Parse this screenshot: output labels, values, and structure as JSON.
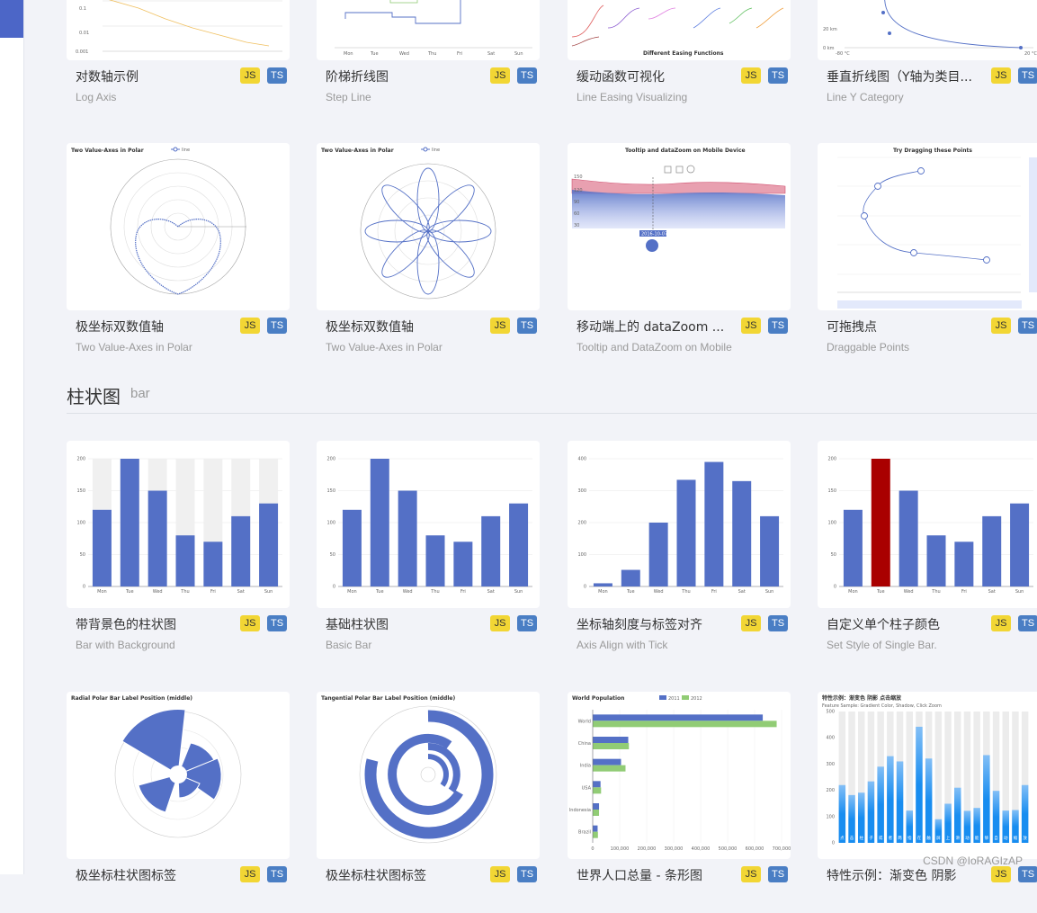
{
  "section": {
    "title": "柱状图",
    "subtitle": "bar"
  },
  "badges": {
    "js": "JS",
    "ts": "TS"
  },
  "cards_row1": [
    {
      "title": "对数轴示例",
      "subtitle": "Log Axis"
    },
    {
      "title": "阶梯折线图",
      "subtitle": "Step Line"
    },
    {
      "title": "缓动函数可视化",
      "subtitle": "Line Easing Visualizing"
    },
    {
      "title": "垂直折线图（Y轴为类目...",
      "subtitle": "Line Y Category"
    }
  ],
  "cards_row2": [
    {
      "title": "极坐标双数值轴",
      "subtitle": "Two Value-Axes in Polar"
    },
    {
      "title": "极坐标双数值轴",
      "subtitle": "Two Value-Axes in Polar"
    },
    {
      "title": "移动端上的 dataZoom ...",
      "subtitle": "Tooltip and DataZoom on Mobile"
    },
    {
      "title": "可拖拽点",
      "subtitle": "Draggable Points"
    }
  ],
  "cards_row3": [
    {
      "title": "带背景色的柱状图",
      "subtitle": "Bar with Background"
    },
    {
      "title": "基础柱状图",
      "subtitle": "Basic Bar"
    },
    {
      "title": "坐标轴刻度与标签对齐",
      "subtitle": "Axis Align with Tick"
    },
    {
      "title": "自定义单个柱子颜色",
      "subtitle": "Set Style of Single Bar."
    }
  ],
  "cards_row4": [
    {
      "title": "极坐标柱状图标签"
    },
    {
      "title": "极坐标柱状图标签"
    },
    {
      "title": "世界人口总量 - 条形图"
    },
    {
      "title": "特性示例：渐变色 阴影"
    }
  ],
  "thumb_text": {
    "easing_title": "Different Easing Functions",
    "polar_title": "Two Value-Axes in Polar",
    "polar_legend": "line",
    "mobile_title": "Tooltip and dataZoom on Mobile Device",
    "mobile_tip": "2016-10-07",
    "drag_title": "Try Dragging these Points",
    "radial_title": "Radial Polar Bar Label Position (middle)",
    "tangential_title": "Tangential Polar Bar Label Position (middle)",
    "world_title": "World Population",
    "world_legend": [
      "2011",
      "2012"
    ],
    "feature_title": "特性示例：渐变色 阴影 点击缩放",
    "feature_subtitle": "Feature Sample: Gradient Color, Shadow, Click Zoom"
  },
  "weekdays": [
    "Mon",
    "Tue",
    "Wed",
    "Thu",
    "Fri",
    "Sat",
    "Sun"
  ],
  "chart_data": [
    {
      "type": "bar",
      "title": "",
      "categories": [
        "Mon",
        "Tue",
        "Wed",
        "Thu",
        "Fri",
        "Sat",
        "Sun"
      ],
      "values": [
        120,
        200,
        150,
        80,
        70,
        110,
        130
      ],
      "background_max": 200,
      "ylim": [
        0,
        200
      ]
    },
    {
      "type": "bar",
      "title": "",
      "categories": [
        "Mon",
        "Tue",
        "Wed",
        "Thu",
        "Fri",
        "Sat",
        "Sun"
      ],
      "values": [
        120,
        200,
        150,
        80,
        70,
        110,
        130
      ],
      "ylim": [
        0,
        200
      ]
    },
    {
      "type": "bar",
      "title": "",
      "categories": [
        "Mon",
        "Tue",
        "Wed",
        "Thu",
        "Fri",
        "Sat",
        "Sun"
      ],
      "values": [
        10,
        52,
        200,
        334,
        390,
        330,
        220
      ],
      "ylim": [
        0,
        400
      ]
    },
    {
      "type": "bar",
      "title": "",
      "categories": [
        "Mon",
        "Tue",
        "Wed",
        "Thu",
        "Fri",
        "Sat",
        "Sun"
      ],
      "values": [
        120,
        200,
        150,
        80,
        70,
        110,
        130
      ],
      "highlight_index": 1,
      "highlight_color": "#a90000",
      "ylim": [
        0,
        200
      ]
    },
    {
      "type": "bar",
      "title": "World Population",
      "orientation": "horizontal",
      "categories": [
        "Brazil",
        "Indonesia",
        "USA",
        "India",
        "China",
        "World"
      ],
      "series": [
        {
          "name": "2011",
          "values": [
            18203,
            23489,
            29034,
            104970,
            131744,
            630230
          ]
        },
        {
          "name": "2012",
          "values": [
            19325,
            23438,
            31000,
            121594,
            134141,
            681807
          ]
        }
      ],
      "xlim": [
        0,
        700000
      ]
    },
    {
      "type": "bar",
      "title": "特性示例：渐变色 阴影 点击缩放",
      "categories": [
        "点",
        "击",
        "柱",
        "子",
        "或",
        "者",
        "两",
        "指",
        "在",
        "触",
        "屏",
        "上",
        "滑",
        "动",
        "能",
        "够",
        "自",
        "动",
        "缩",
        "放"
      ],
      "values": [
        220,
        182,
        191,
        234,
        290,
        330,
        310,
        123,
        442,
        321,
        90,
        149,
        210,
        122,
        133,
        334,
        198,
        123,
        125,
        220
      ],
      "background_max": 500,
      "ylim": [
        0,
        500
      ]
    }
  ],
  "colors": {
    "accent": "#5470c6",
    "green": "#91cc75",
    "badge_js": "#f2d634",
    "badge_ts": "#4a7ec4",
    "highlight": "#a90000"
  },
  "watermark": "CSDN @IoRAGIzAP"
}
